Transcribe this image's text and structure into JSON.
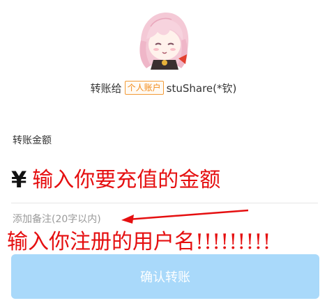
{
  "recipient": {
    "avatar_icon": "anime-avatar-icon",
    "prefix": "转账给",
    "account_badge": "个人账户",
    "name": "stuShare(*钦)"
  },
  "amount": {
    "label": "转账金额",
    "currency_symbol": "¥",
    "placeholder": "输入你要充值的金额"
  },
  "note": {
    "link_text": "添加备注(20字以内)"
  },
  "annotation": {
    "text": "输入你注册的用户名!!!!!!!!!"
  },
  "actions": {
    "confirm_label": "确认转账"
  },
  "colors": {
    "badge_orange": "#f28a18",
    "annotation_red": "#e50f10",
    "button_disabled_blue": "#a9d9fa"
  }
}
